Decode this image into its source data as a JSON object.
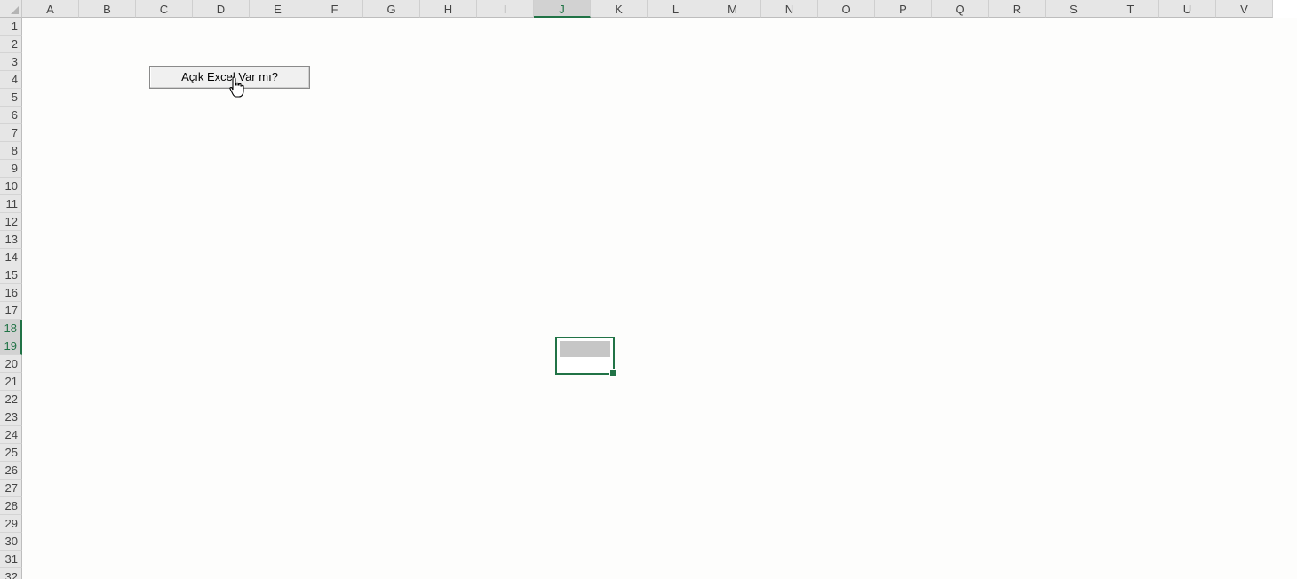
{
  "columns": [
    "A",
    "B",
    "C",
    "D",
    "E",
    "F",
    "G",
    "H",
    "I",
    "J",
    "K",
    "L",
    "M",
    "N",
    "O",
    "P",
    "Q",
    "R",
    "S",
    "T",
    "U",
    "V"
  ],
  "rows": [
    "1",
    "2",
    "3",
    "4",
    "5",
    "6",
    "7",
    "8",
    "9",
    "10",
    "11",
    "12",
    "13",
    "14",
    "15",
    "16",
    "17",
    "18",
    "19",
    "20",
    "21",
    "22",
    "23",
    "24",
    "25",
    "26",
    "27",
    "28",
    "29",
    "30",
    "31",
    "32"
  ],
  "selection": {
    "column": "J",
    "rows": [
      "18",
      "19"
    ]
  },
  "button": {
    "label": "Açık Excel Var mı?"
  },
  "colors": {
    "accent": "#217346",
    "header_bg": "#e6e6e6",
    "selected_header_bg": "#d2d2d2"
  },
  "icons": {
    "cursor": "hand-pointer-icon"
  }
}
